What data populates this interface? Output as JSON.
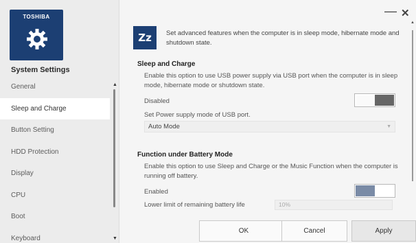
{
  "app": {
    "brand": "TOSHIBA",
    "title": "System Settings"
  },
  "sidebar": {
    "items": [
      {
        "label": "General"
      },
      {
        "label": "Sleep and Charge",
        "active": true
      },
      {
        "label": "Button Setting"
      },
      {
        "label": "HDD Protection"
      },
      {
        "label": "Display"
      },
      {
        "label": "CPU"
      },
      {
        "label": "Boot"
      },
      {
        "label": "Keyboard"
      }
    ]
  },
  "window_controls": {
    "minimize": "—",
    "close": "✕"
  },
  "content": {
    "icon_text": "Zz",
    "intro": "Set advanced features when the computer is in sleep mode, hibernate mode and shutdown state.",
    "sleep_and_charge": {
      "title": "Sleep and Charge",
      "description": "Enable this option to use USB power supply via USB port when the computer is in sleep mode, hibernate mode or shutdown state.",
      "toggle_label": "Disabled",
      "toggle_state": "off",
      "mode_label": "Set Power supply mode of USB port.",
      "mode_value": "Auto Mode"
    },
    "battery_mode": {
      "title": "Function under Battery Mode",
      "description": "Enable this option to use Sleep and Charge or the Music Function when the computer is running off battery.",
      "toggle_label": "Enabled",
      "toggle_state": "on",
      "limit_label": "Lower limit of remaining battery life",
      "limit_value": "10%"
    }
  },
  "buttons": {
    "ok": "OK",
    "cancel": "Cancel",
    "apply": "Apply"
  },
  "colors": {
    "brand_blue": "#1c3f73",
    "toggle_on": "#7a8ba6",
    "toggle_off": "#666666"
  }
}
